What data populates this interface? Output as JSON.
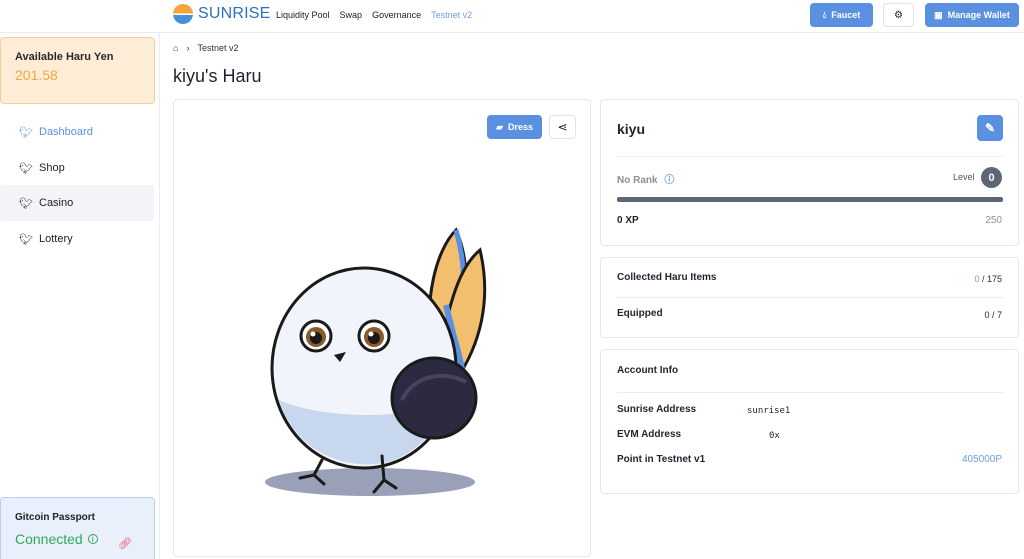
{
  "header": {
    "brand": "SUNRISE",
    "nav": [
      "Liquidity Pool",
      "Swap",
      "Governance",
      "Testnet v2"
    ],
    "faucet_label": "Faucet",
    "manage_wallet_label": "Manage Wallet"
  },
  "sidebar": {
    "balance_label": "Available Haru Yen",
    "balance_value": "201.58",
    "items": [
      {
        "label": "Dashboard",
        "icon": "dashboard-icon"
      },
      {
        "label": "Shop",
        "icon": "shop-icon"
      },
      {
        "label": "Casino",
        "icon": "casino-icon"
      },
      {
        "label": "Lottery",
        "icon": "lottery-icon"
      }
    ],
    "passport_title": "Gitcoin Passport",
    "passport_status": "Connected"
  },
  "breadcrumb": {
    "current": "Testnet v2"
  },
  "page_title": "kiyu's Haru",
  "haru_panel": {
    "dress_label": "Dress"
  },
  "profile": {
    "name": "kiyu",
    "rank": "No Rank",
    "level_label": "Level",
    "level_value": "0",
    "xp": "0 XP",
    "xp_max": "250",
    "progress": 0
  },
  "items": {
    "collected_label": "Collected Haru Items",
    "collected_count": "0",
    "collected_total": "/ 175",
    "equipped_label": "Equipped",
    "equipped_count": "0",
    "equipped_total": "/ 7"
  },
  "account": {
    "title": "Account Info",
    "sunrise_label": "Sunrise Address",
    "sunrise_value": "sunrise1",
    "evm_label": "EVM Address",
    "evm_value": "0x",
    "points_label": "Point in Testnet v1",
    "points_value": "405000P"
  },
  "colors": {
    "accent": "#5a90e0",
    "balance": "#f0a845",
    "connected": "#2faa5a"
  }
}
